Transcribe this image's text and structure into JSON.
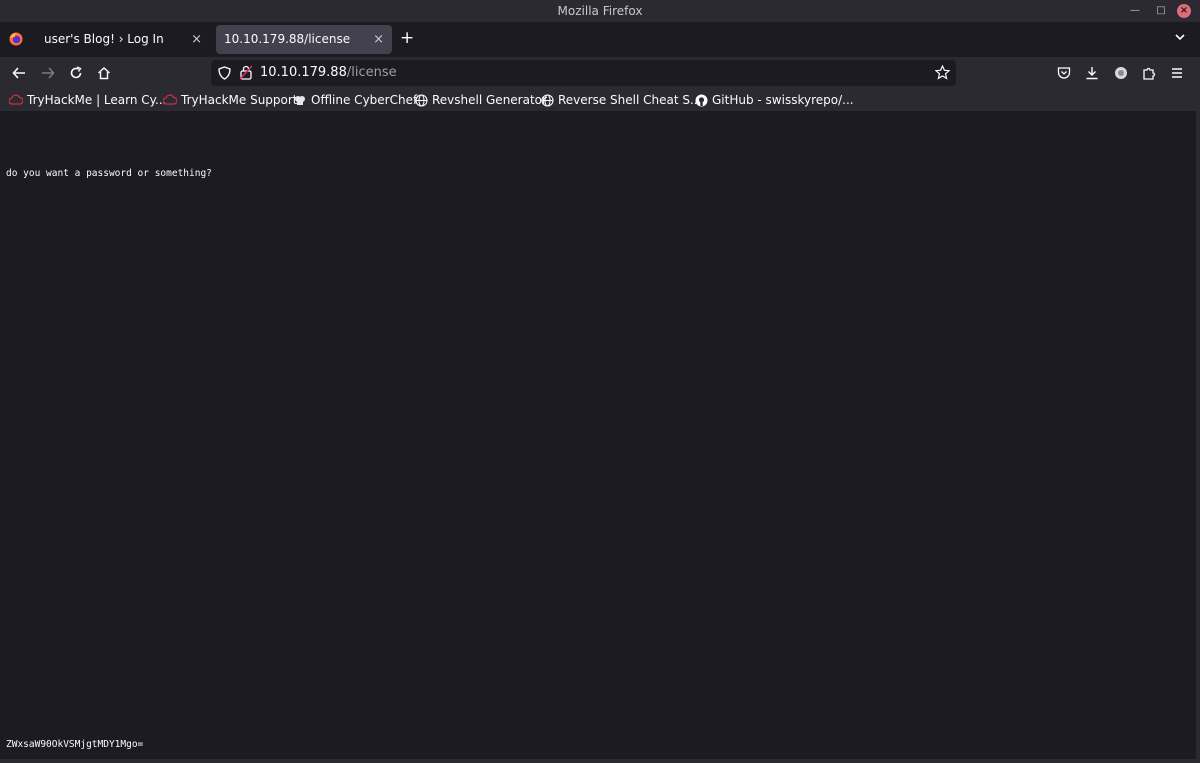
{
  "window": {
    "title": "Mozilla Firefox"
  },
  "tabs": [
    {
      "label": "user's Blog! › Log In"
    },
    {
      "label": "10.10.179.88/license"
    }
  ],
  "nav": {
    "url_host": "10.10.179.88",
    "url_path": "/license"
  },
  "bookmarks": [
    {
      "label": "TryHackMe | Learn Cy...",
      "icon": "tryhackme-icon"
    },
    {
      "label": "TryHackMe Support",
      "icon": "tryhackme-icon"
    },
    {
      "label": "Offline CyberChef",
      "icon": "chef-hat-icon"
    },
    {
      "label": "Revshell Generator",
      "icon": "globe-icon"
    },
    {
      "label": "Reverse Shell Cheat S...",
      "icon": "globe-icon"
    },
    {
      "label": "GitHub - swisskyrepo/...",
      "icon": "github-icon"
    }
  ],
  "page": {
    "message": "do you want a password or something?",
    "encoded": "ZWxsaW90OkVSMjgtMDY1Mgo="
  },
  "colors": {
    "accent_close": "#e06c75",
    "tryhackme": "#c7313f"
  }
}
